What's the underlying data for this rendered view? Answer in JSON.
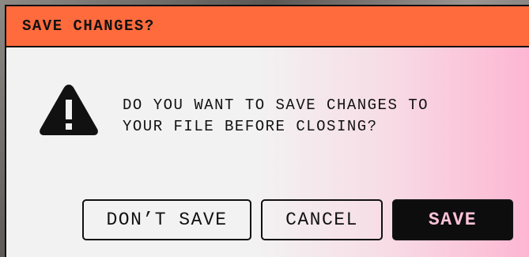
{
  "dialog": {
    "title": "SAVE CHANGES?",
    "message": "DO YOU WANT TO SAVE CHANGES TO\nYOUR FILE BEFORE CLOSING?",
    "icon": "warning-triangle-icon",
    "buttons": {
      "dont_save": "DON’T SAVE",
      "cancel": "CANCEL",
      "save": "SAVE"
    }
  },
  "colors": {
    "titlebar": "#ff6b3d",
    "primary_button_bg": "#0d0d0d",
    "primary_button_text": "#ffc2d9",
    "gradient_end": "#fdb6d2"
  }
}
